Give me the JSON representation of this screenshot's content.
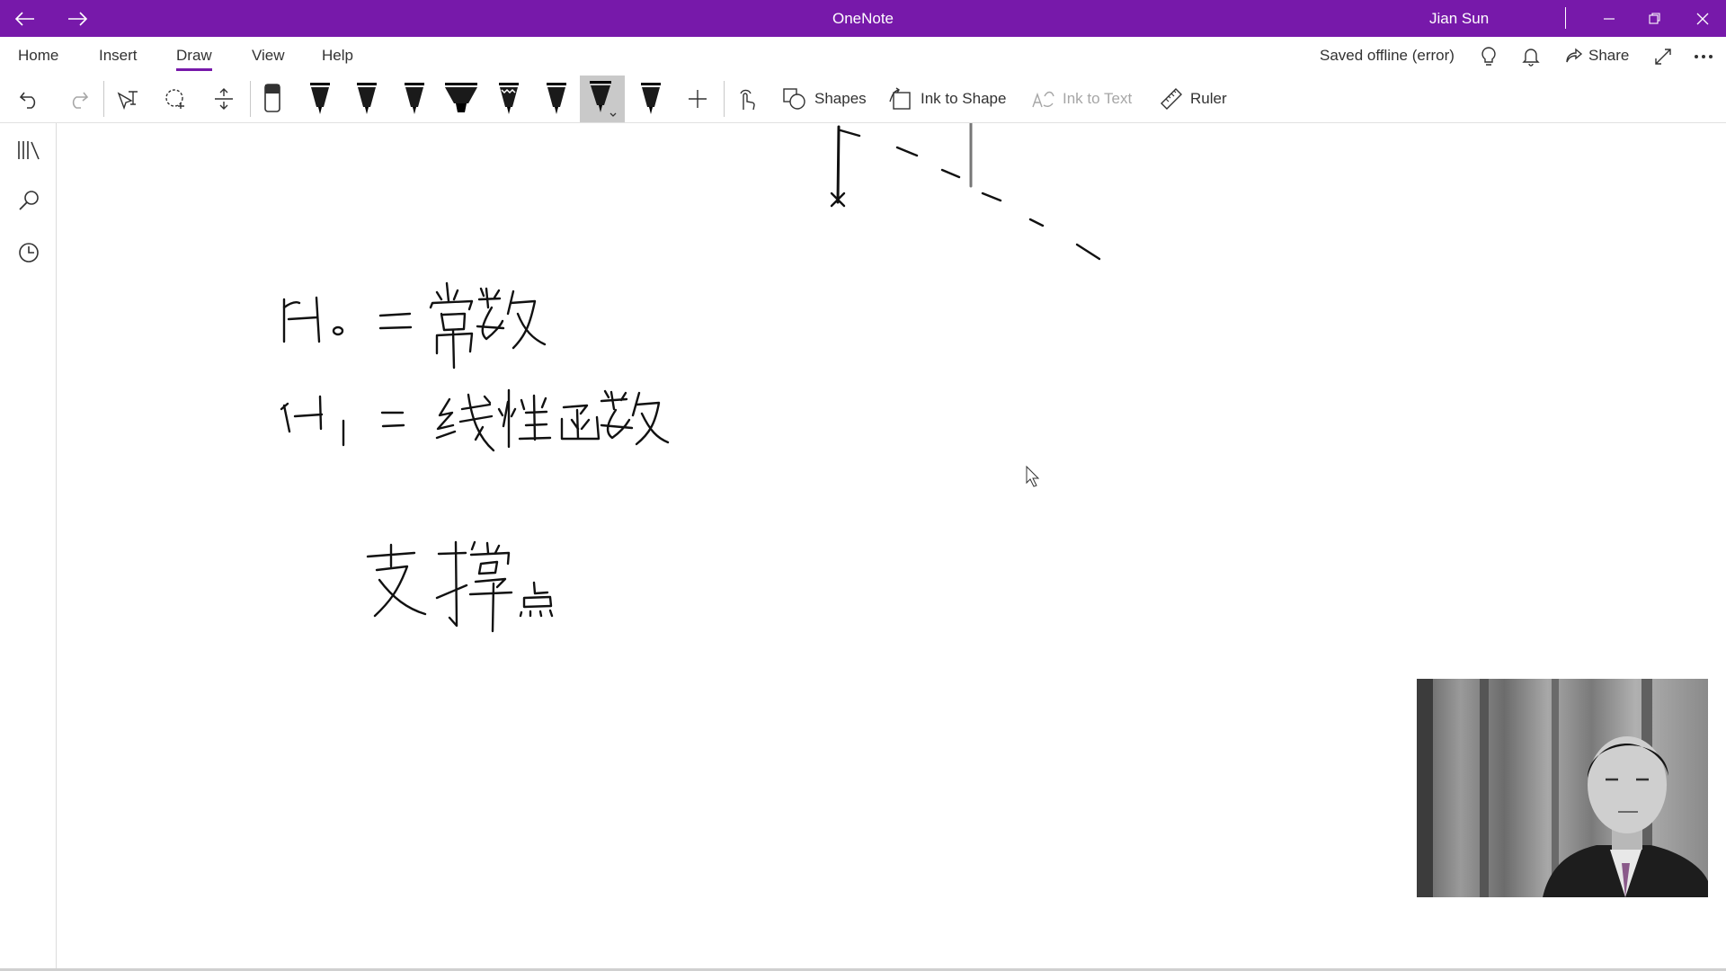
{
  "app": {
    "title": "OneNote",
    "user": "Jian Sun"
  },
  "window_controls": [
    "back-arrow-icon",
    "forward-arrow-icon",
    "minimize-icon",
    "restore-icon",
    "close-icon"
  ],
  "menu": {
    "tabs": [
      {
        "label": "Home"
      },
      {
        "label": "Insert"
      },
      {
        "label": "Draw",
        "active": true
      },
      {
        "label": "View"
      },
      {
        "label": "Help"
      }
    ],
    "status": "Saved offline (error)",
    "share_label": "Share"
  },
  "toolbar": {
    "shapes_label": "Shapes",
    "ink_to_shape_label": "Ink to Shape",
    "ink_to_text_label": "Ink to Text",
    "ruler_label": "Ruler"
  },
  "colors": {
    "accent": "#7719aa",
    "ink": "#000000",
    "selected_pen_bg": "#c9c9c9"
  },
  "sidebar_icons": [
    "notebooks-icon",
    "search-icon",
    "recent-clock-icon"
  ],
  "canvas": {
    "handwriting": [
      "H₀ = 常数",
      "H₁ = 线性函数",
      "支撑点"
    ]
  }
}
